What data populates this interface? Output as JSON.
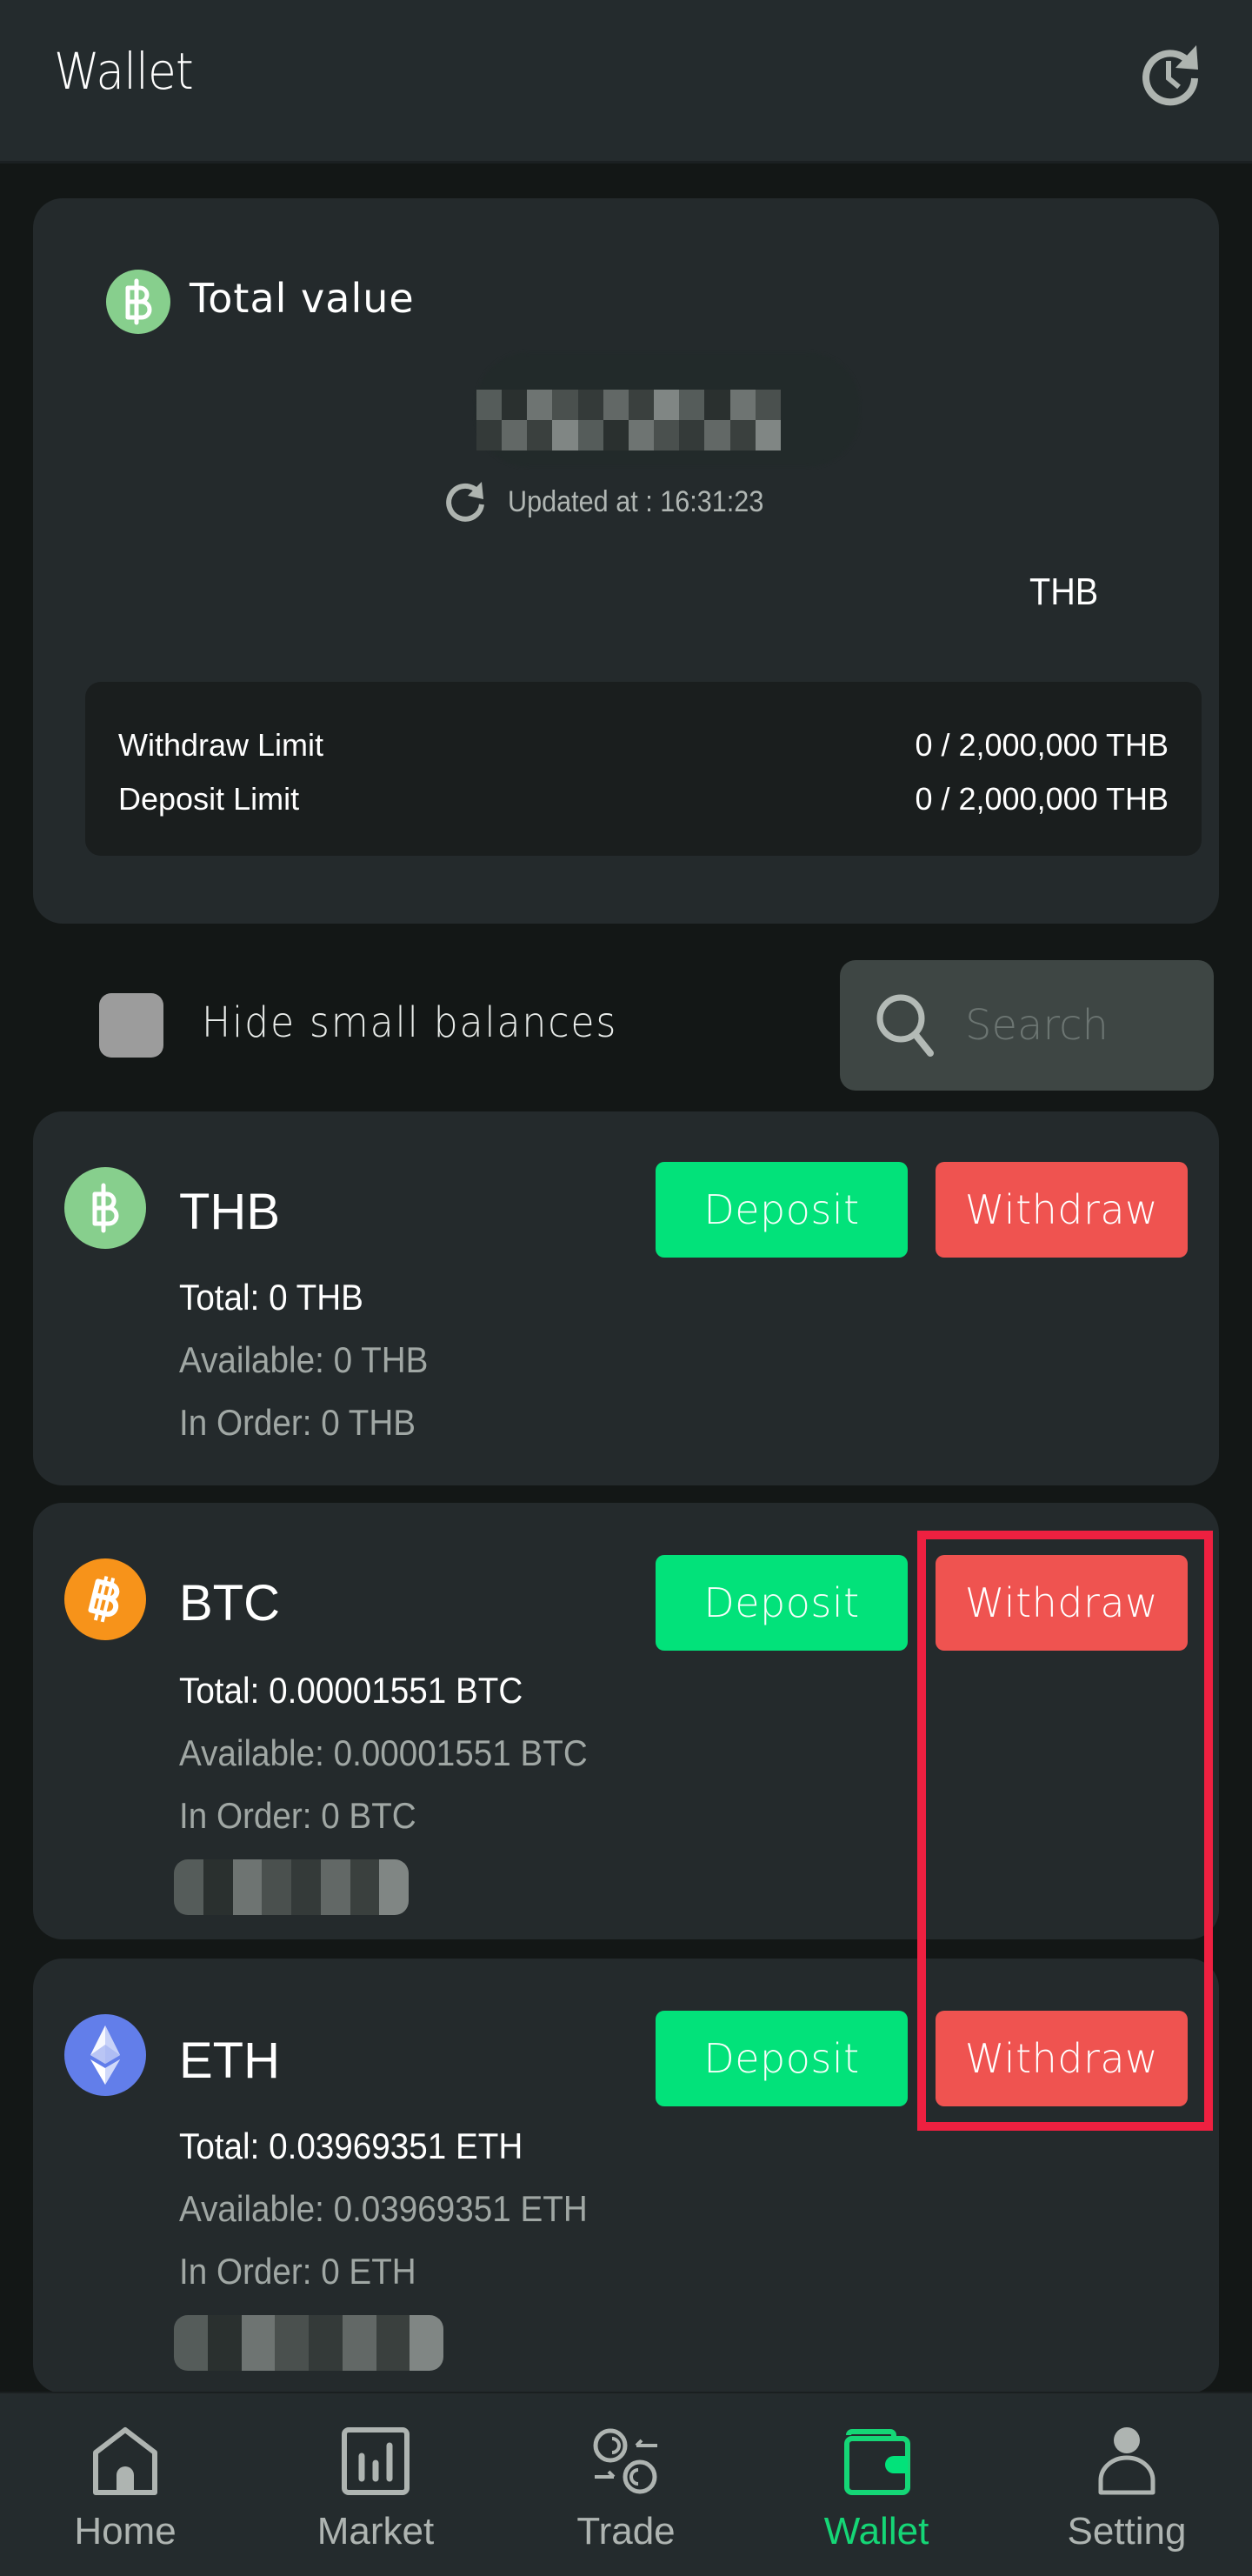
{
  "header": {
    "title": "Wallet",
    "history_icon": "history-clock-icon"
  },
  "summary": {
    "label": "Total value",
    "icon": "baht-icon",
    "value_redacted": true,
    "updated_label": "Updated at : 16:31:23",
    "currency": "THB",
    "limits": [
      {
        "label": "Withdraw Limit",
        "value": "0 / 2,000,000 THB"
      },
      {
        "label": "Deposit Limit",
        "value": "0 / 2,000,000 THB"
      }
    ]
  },
  "filters": {
    "hide_small_label": "Hide small balances",
    "hide_small_checked": false,
    "search_placeholder": "Search",
    "search_value": ""
  },
  "assets": [
    {
      "symbol": "THB",
      "icon": "baht-icon",
      "color": "#87cf8d",
      "total": "Total: 0 THB",
      "available": "Available: 0 THB",
      "in_order": "In Order: 0 THB",
      "deposit_label": "Deposit",
      "withdraw_label": "Withdraw"
    },
    {
      "symbol": "BTC",
      "icon": "bitcoin-icon",
      "color": "#f7931a",
      "total": "Total: 0.00001551 BTC",
      "available": "Available: 0.00001551 BTC",
      "in_order": "In Order: 0 BTC",
      "deposit_label": "Deposit",
      "withdraw_label": "Withdraw"
    },
    {
      "symbol": "ETH",
      "icon": "ethereum-icon",
      "color": "#627eea",
      "total": "Total: 0.03969351 ETH",
      "available": "Available: 0.03969351 ETH",
      "in_order": "In Order: 0 ETH",
      "deposit_label": "Deposit",
      "withdraw_label": "Withdraw"
    }
  ],
  "nav": {
    "items": [
      {
        "label": "Home",
        "icon": "home-icon",
        "active": false
      },
      {
        "label": "Market",
        "icon": "market-chart-icon",
        "active": false
      },
      {
        "label": "Trade",
        "icon": "trade-exchange-icon",
        "active": false
      },
      {
        "label": "Wallet",
        "icon": "wallet-icon",
        "active": true
      },
      {
        "label": "Setting",
        "icon": "user-icon",
        "active": false
      }
    ]
  },
  "colors": {
    "accent_green": "#02e27a",
    "danger_red": "#ef5350",
    "nav_active": "#15d676",
    "highlight": "#ee2040"
  }
}
